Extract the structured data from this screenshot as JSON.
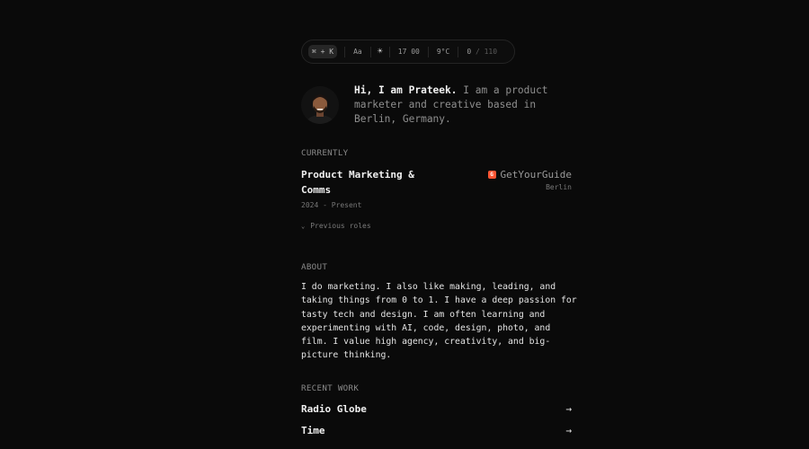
{
  "toolbar": {
    "shortcut": "⌘ + K",
    "font_toggle": "Aa",
    "theme_icon": "sun-icon",
    "time": "17 00",
    "temperature": "9°C",
    "count_current": "0",
    "count_sep": " / ",
    "count_total": "110"
  },
  "intro": {
    "greeting": "Hi, I am Prateek.",
    "bio": " I am a product marketer and creative based in Berlin, Germany."
  },
  "currently": {
    "label": "CURRENTLY",
    "role": "Product Marketing & Comms",
    "company": "GetYourGuide",
    "company_logo_letter": "G",
    "city": "Berlin",
    "dates": "2024 - Present",
    "previous_roles": "Previous roles"
  },
  "about": {
    "label": "ABOUT",
    "text": "I do marketing. I also like making, leading, and taking things from 0 to 1. I have a deep passion for tasty tech and design. I am often learning and experimenting with AI, code, design, photo, and film. I value high agency, creativity, and big-picture thinking."
  },
  "recent_work": {
    "label": "RECENT WORK",
    "items": [
      {
        "title": "Radio Globe",
        "icon": "arrow-right-icon"
      },
      {
        "title": "Time",
        "icon": "arrow-right-icon"
      },
      {
        "title": "",
        "icon": "arrow-right-icon"
      }
    ]
  },
  "colors": {
    "background": "#0a0a0a",
    "text": "#f0f0f0",
    "muted": "#8a8a8a",
    "brand_logo": "#ff5533"
  }
}
